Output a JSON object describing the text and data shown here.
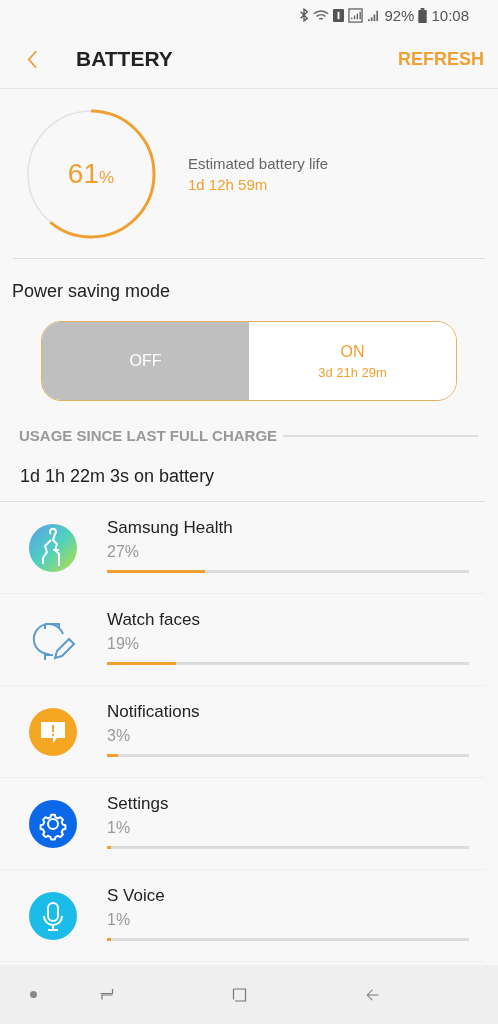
{
  "status_bar": {
    "battery": "92%",
    "time": "10:08"
  },
  "header": {
    "title": "BATTERY",
    "action": "REFRESH"
  },
  "battery": {
    "percent": "61",
    "percent_sign": "%",
    "estimate_label": "Estimated battery life",
    "estimate": "1d 12h 59m"
  },
  "power_saving": {
    "title": "Power saving mode",
    "options": [
      {
        "label": "OFF",
        "selected": true
      },
      {
        "label": "ON",
        "sublabel": "3d 21h 29m",
        "selected": false
      }
    ]
  },
  "usage": {
    "heading": "USAGE SINCE LAST FULL CHARGE",
    "on_battery": "1d 1h 22m 3s on battery",
    "apps": [
      {
        "kind": "health",
        "name": "Samsung Health",
        "percent": "27%",
        "level": 0.27
      },
      {
        "kind": "watch",
        "name": "Watch faces",
        "percent": "19%",
        "level": 0.19
      },
      {
        "kind": "notification",
        "name": "Notifications",
        "percent": "3%",
        "level": 0.03
      },
      {
        "kind": "settings",
        "name": "Settings",
        "percent": "1%",
        "level": 0.01
      },
      {
        "kind": "voice",
        "name": "S Voice",
        "percent": "1%",
        "level": 0.01
      }
    ]
  }
}
